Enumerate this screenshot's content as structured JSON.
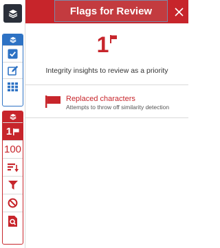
{
  "header": {
    "title": "Flags for Review",
    "close_icon": "close-icon"
  },
  "rail": {
    "layers_icon": "layers-icon",
    "similarity_group": {
      "head_icon": "layers-icon",
      "items": [
        {
          "icon": "check-square-icon"
        },
        {
          "icon": "edit-icon"
        },
        {
          "icon": "grid-icon"
        }
      ]
    },
    "integrity_group": {
      "head_icon": "layers-icon",
      "flag_count": "1",
      "score": "100",
      "items": [
        {
          "icon": "sort-icon"
        },
        {
          "icon": "filter-icon"
        },
        {
          "icon": "ban-icon"
        },
        {
          "icon": "search-document-icon"
        }
      ]
    }
  },
  "summary": {
    "count": "1",
    "text": "Integrity insights to review as a priority"
  },
  "flags": [
    {
      "title": "Replaced characters",
      "description": "Attempts to throw off similarity detection"
    }
  ],
  "colors": {
    "accent_red": "#c7252b",
    "accent_blue": "#2d72c4",
    "dark": "#2a2f3a"
  }
}
